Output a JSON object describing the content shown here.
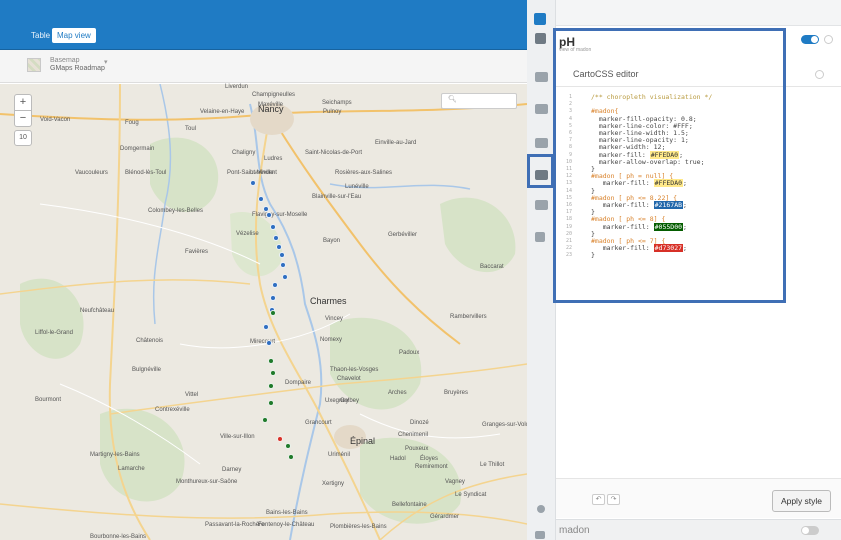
{
  "view_tabs": {
    "table": "Table",
    "map": "Map view"
  },
  "basemap": {
    "label": "Basemap",
    "value": "GMaps Roadmap"
  },
  "map": {
    "zoom_in": "+",
    "zoom_out": "−",
    "zoom_level": "10",
    "towns": [
      "Nancy",
      "Toul",
      "Lunéville",
      "Épinal",
      "Charmes",
      "Mirecourt",
      "Neufchâteau",
      "Vittel",
      "Contrexéville",
      "Remiremont",
      "Baccarat",
      "Rambervillers",
      "Bayon",
      "Dompaire",
      "Plombières-les-Bains",
      "Bourbonne-les-Bains",
      "Saint-Nicolas-de-Port",
      "Pont-Saint-Vincent",
      "Flavigny-sur-Moselle",
      "Vézelise",
      "Favières",
      "Colombey-les-Belles",
      "Void-Vacon",
      "Liffol-le-Grand",
      "Châtenois",
      "Bulgnéville",
      "Bourmont",
      "Darney",
      "Monthureux-sur-Saône",
      "Xertigny",
      "Gérardmer",
      "Le Thillot",
      "Bains-les-Bains",
      "Vagney",
      "Rosières-aux-Salines",
      "Blainville-sur-l'Eau",
      "Vincey",
      "Nomexy",
      "Thaon-les-Vosges",
      "Chavelot",
      "Uxegney",
      "Golbey",
      "Arches",
      "Bruyères",
      "Padoux",
      "Gerbéviller",
      "Einville-au-Jard",
      "Champigneulles",
      "Maxéville",
      "Seichamps",
      "Pulnoy",
      "Chaligny",
      "Ludres",
      "Velaine-en-Haye",
      "Foug",
      "Domgermain",
      "Vaucouleurs",
      "Blénod-lès-Toul",
      "Liverdun",
      "Passavant-la-Rochère",
      "Fontenoy-le-Château",
      "Lamarche",
      "Martigny-les-Bains",
      "Bellefontaine",
      "Le Syndicat",
      "Granges-sur-Vologne",
      "Chenimenil",
      "Pouxeux",
      "Éloyes",
      "Hadol",
      "Uriménil",
      "Grancourt",
      "Dinozé",
      "Ville-sur-Illon",
      "Lunéville"
    ],
    "points": [
      {
        "color": "blue"
      },
      {
        "color": "blue"
      },
      {
        "color": "blue"
      },
      {
        "color": "blue"
      },
      {
        "color": "blue"
      },
      {
        "color": "blue"
      },
      {
        "color": "blue"
      },
      {
        "color": "blue"
      },
      {
        "color": "blue"
      },
      {
        "color": "blue"
      },
      {
        "color": "blue"
      },
      {
        "color": "blue"
      },
      {
        "color": "blue"
      },
      {
        "color": "green"
      },
      {
        "color": "blue"
      },
      {
        "color": "blue"
      },
      {
        "color": "green"
      },
      {
        "color": "green"
      },
      {
        "color": "green"
      },
      {
        "color": "green"
      },
      {
        "color": "green"
      },
      {
        "color": "red"
      },
      {
        "color": "green"
      },
      {
        "color": "green"
      }
    ]
  },
  "layer": {
    "title": "pH",
    "subtitle": "view of madon"
  },
  "editor": {
    "title": "CartoCSS editor",
    "lines": [
      {
        "n": "1",
        "t": "/** choropleth visualization */"
      },
      {
        "n": "2",
        "t": ""
      },
      {
        "n": "3",
        "t": "#madon{"
      },
      {
        "n": "4",
        "t": "  marker-fill-opacity: 0.8;"
      },
      {
        "n": "5",
        "t": "  marker-line-color: #FFF;"
      },
      {
        "n": "6",
        "t": "  marker-line-width: 1.5;"
      },
      {
        "n": "7",
        "t": "  marker-line-opacity: 1;"
      },
      {
        "n": "8",
        "t": "  marker-width: 12;"
      },
      {
        "n": "9",
        "t": "  marker-fill: #FFEDA0;"
      },
      {
        "n": "10",
        "t": "  marker-allow-overlap: true;"
      },
      {
        "n": "11",
        "t": "}"
      },
      {
        "n": "12",
        "t": "#madon [ ph = null] {"
      },
      {
        "n": "13",
        "t": "   marker-fill: #FFEDA0;"
      },
      {
        "n": "14",
        "t": "}"
      },
      {
        "n": "15",
        "t": "#madon [ ph <= 8.22] {"
      },
      {
        "n": "16",
        "t": "   marker-fill: #2167AB;"
      },
      {
        "n": "17",
        "t": "}"
      },
      {
        "n": "18",
        "t": "#madon [ ph <= 8] {"
      },
      {
        "n": "19",
        "t": "   marker-fill: #055D00;"
      },
      {
        "n": "20",
        "t": "}"
      },
      {
        "n": "21",
        "t": "#madon [ ph <= 7] {"
      },
      {
        "n": "22",
        "t": "   marker-fill: #d73027;"
      },
      {
        "n": "23",
        "t": "}"
      }
    ],
    "undo": "↶",
    "redo": "↷",
    "apply_label": "Apply style"
  },
  "next_layer": {
    "name": "madon"
  },
  "colors": {
    "accent": "#1f7bc4",
    "highlight": "#3f6fb5",
    "point_blue": "#2f6ec1",
    "point_green": "#1f7a2a",
    "point_red": "#d73027"
  }
}
